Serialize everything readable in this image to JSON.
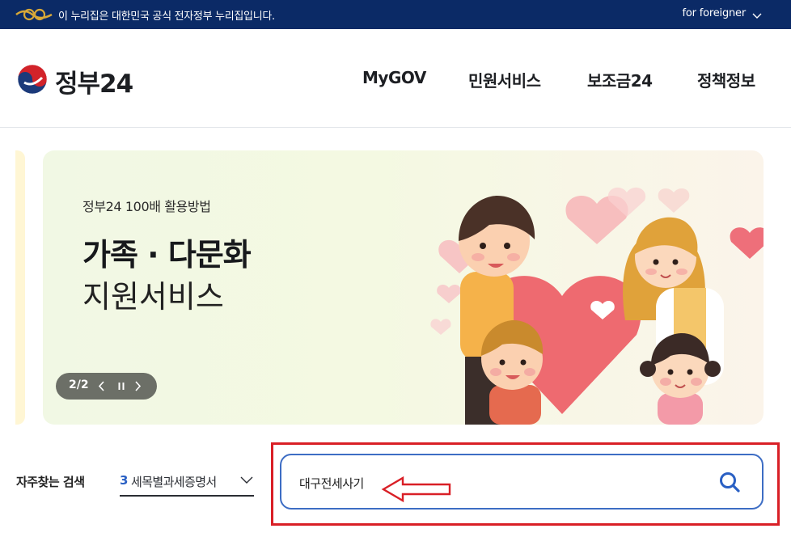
{
  "topbar": {
    "notice": "이 누리집은 대한민국 공식 전자정부 누리집입니다.",
    "foreigner_label": "for foreigner",
    "chevron_icon": "chevron-down-icon",
    "background_color": "#0b2a66"
  },
  "header": {
    "logo_text": "정부24",
    "nav": [
      {
        "label": "MyGOV"
      },
      {
        "label": "민원서비스"
      },
      {
        "label": "보조금24"
      },
      {
        "label": "정책정보"
      }
    ]
  },
  "banner": {
    "eyebrow": "정부24 100배 활용방법",
    "headline": "가족 · 다문화",
    "subline": "지원서비스",
    "counter": "2/2",
    "icons": [
      "chevron-left-icon",
      "pause-icon",
      "chevron-right-icon"
    ]
  },
  "frequent": {
    "label": "자주찾는 검색",
    "selected_rank": "3",
    "selected_text": "세목별과세증명서"
  },
  "search": {
    "value": "대구전세사기",
    "button_icon": "search-icon",
    "accent_color": "#3d6dc4"
  },
  "annotation": {
    "highlight_color": "#d91f26"
  }
}
